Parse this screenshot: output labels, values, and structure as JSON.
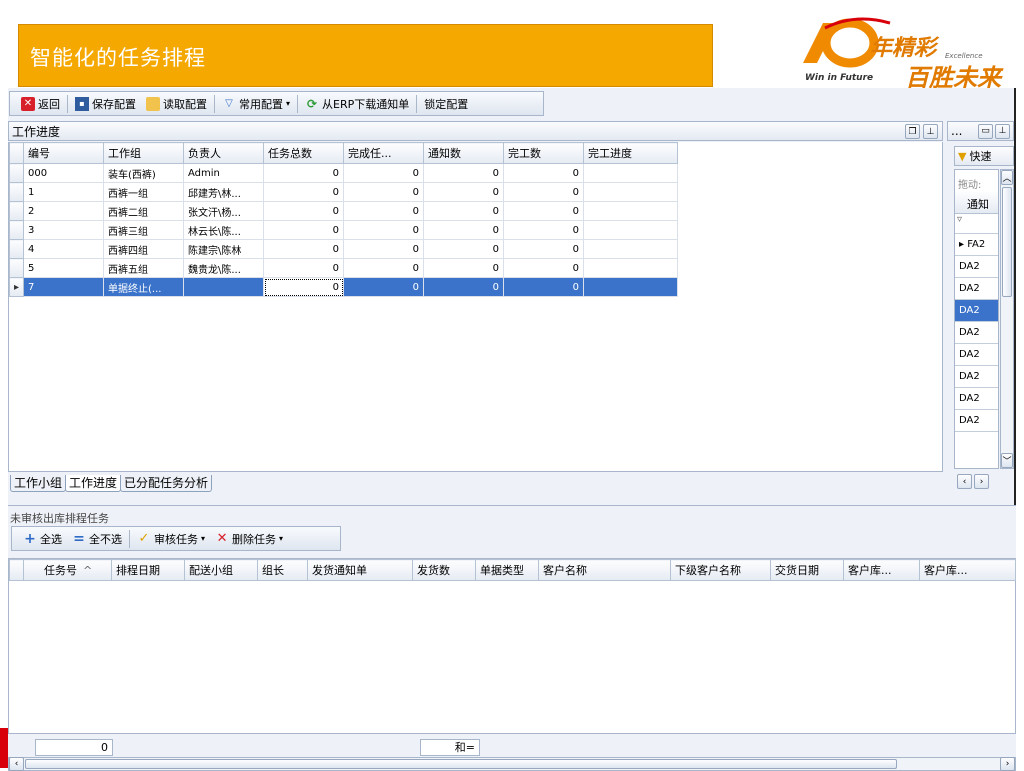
{
  "slide": {
    "title": "智能化的任务排程",
    "logo": {
      "main": "年精彩",
      "sub": "百胜未来",
      "tagline": "Win in Future",
      "excellence": "Excellence"
    }
  },
  "toolbar": {
    "back": "返回",
    "save_config": "保存配置",
    "read_config": "读取配置",
    "common_config": "常用配置",
    "download_erp": "从ERP下载通知单",
    "lock_config": "锁定配置"
  },
  "top_panel": {
    "title": "工作进度",
    "columns": [
      "编号",
      "工作组",
      "负责人",
      "任务总数",
      "完成任...",
      "通知数",
      "完工数",
      "完工进度"
    ],
    "rows": [
      [
        "000",
        "装车(西裤)",
        "Admin",
        "0",
        "0",
        "0",
        "0",
        ""
      ],
      [
        "1",
        "西裤一组",
        "邱建芳\\林...",
        "0",
        "0",
        "0",
        "0",
        ""
      ],
      [
        "2",
        "西裤二组",
        "张文汗\\杨...",
        "0",
        "0",
        "0",
        "0",
        ""
      ],
      [
        "3",
        "西裤三组",
        "林云长\\陈...",
        "0",
        "0",
        "0",
        "0",
        ""
      ],
      [
        "4",
        "西裤四组",
        "陈建宗\\陈林",
        "0",
        "0",
        "0",
        "0",
        ""
      ],
      [
        "5",
        "西裤五组",
        "魏贵龙\\陈...",
        "0",
        "0",
        "0",
        "0",
        ""
      ],
      [
        "7",
        "单据终止(...",
        "",
        "0",
        "0",
        "0",
        "0",
        ""
      ]
    ],
    "tabs": [
      "工作小组",
      "工作进度",
      "已分配任务分析"
    ],
    "active_tab": "工作进度"
  },
  "side_panel": {
    "dots": "...",
    "quick_label": "快速",
    "drag_label": "拖动:",
    "header": "通知",
    "rows": [
      "FA2",
      "DA2",
      "DA2",
      "DA2",
      "DA2",
      "DA2",
      "DA2",
      "DA2",
      "DA2"
    ]
  },
  "bottom_panel": {
    "title": "未审核出库排程任务",
    "toolbar": {
      "select_all": "全选",
      "deselect_all": "全不选",
      "approve": "审核任务",
      "delete": "删除任务"
    },
    "columns": [
      "任务号",
      "排程日期",
      "配送小组",
      "组长",
      "发货通知单",
      "发货数",
      "单据类型",
      "客户名称",
      "下级客户名称",
      "交货日期",
      "客户库...",
      "客户库..."
    ],
    "footer": {
      "count": "0",
      "sum": "和="
    }
  },
  "colors": {
    "banner": "#f5a800",
    "selection": "#3a73c9",
    "accent_red": "#d8000a"
  }
}
